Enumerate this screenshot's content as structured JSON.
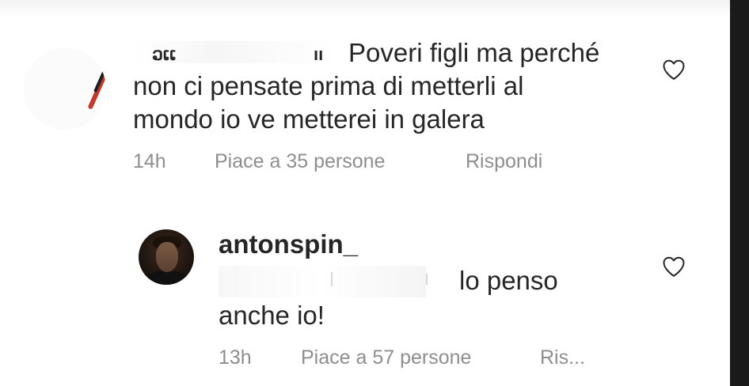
{
  "comments": [
    {
      "username_fragment_left": "ວເເ",
      "username_fragment_right": "ıı",
      "text_line1": "Poveri figli ma perché",
      "text_line2": "non ci pensate prima di metterli al",
      "text_line3": "mondo io ve metterei in galera",
      "time": "14h",
      "likes": "Piace a 35 persone",
      "reply": "Rispondi",
      "heart_icon": "heart-outline-icon"
    },
    {
      "username": "antonspin_",
      "text_line1": "lo penso",
      "text_line2": "anche io!",
      "time": "13h",
      "likes": "Piace a 57 persone",
      "reply": "Ris...",
      "heart_icon": "heart-outline-icon"
    }
  ],
  "colors": {
    "text": "#262626",
    "meta": "#8e8e8e",
    "background": "#ffffff"
  }
}
